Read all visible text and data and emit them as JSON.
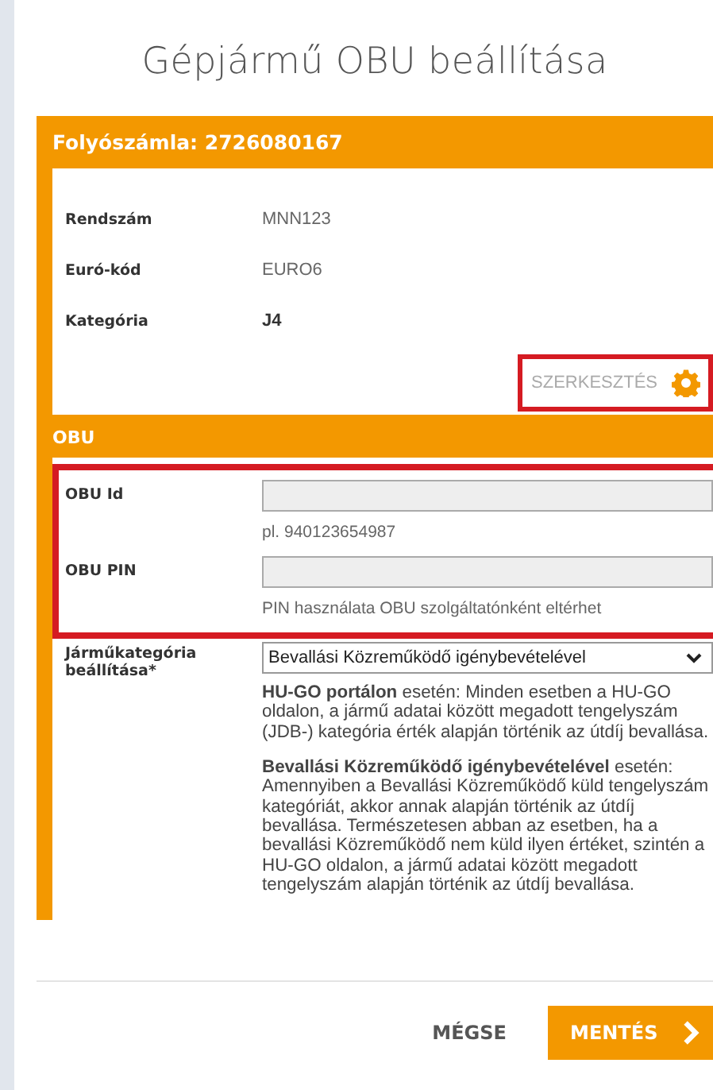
{
  "title": "Gépjármű OBU beállítása",
  "account": {
    "header": "Folyószámla: 2726080167",
    "rows": [
      {
        "label": "Rendszám",
        "value": "MNN123",
        "bold": false
      },
      {
        "label": "Euró-kód",
        "value": "EURO6",
        "bold": false
      },
      {
        "label": "Kategória",
        "value": "J4",
        "bold": true
      }
    ],
    "edit": {
      "label": "SZERKESZTÉS",
      "highlighted": true
    }
  },
  "obu": {
    "header": "OBU",
    "highlighted": true,
    "fields": [
      {
        "label": "OBU Id",
        "hint": "pl. 940123654987"
      },
      {
        "label": "OBU PIN",
        "hint": "PIN használata OBU szolgáltatónként eltérhet"
      }
    ],
    "category": {
      "label": "Járműkategória beállítása*",
      "value": "Bevallási Közreműködő igénybevételével",
      "notes": [
        "**HU-GO portálon** esetén: Minden esetben a HU-GO oldalon, a jármű adatai között megadott tengelyszám (JDB-) kategória érték alapján történik az útdíj bevallása.",
        "**Bevallási Közreműködő igénybevételével** esetén: Amennyiben a Bevallási Közreműködő küld tengelyszám kategóriát, akkor annak alapján történik az útdíj bevallása. Természetesen abban az esetben, ha a bevallási Közreműködő nem küld ilyen értéket, szintén a HU-GO oldalon, a jármű adatai között megadott tengelyszám alapján történik az útdíj bevallása."
      ]
    }
  },
  "buttons": {
    "cancel": "MÉGSE",
    "save": "MENTÉS"
  }
}
